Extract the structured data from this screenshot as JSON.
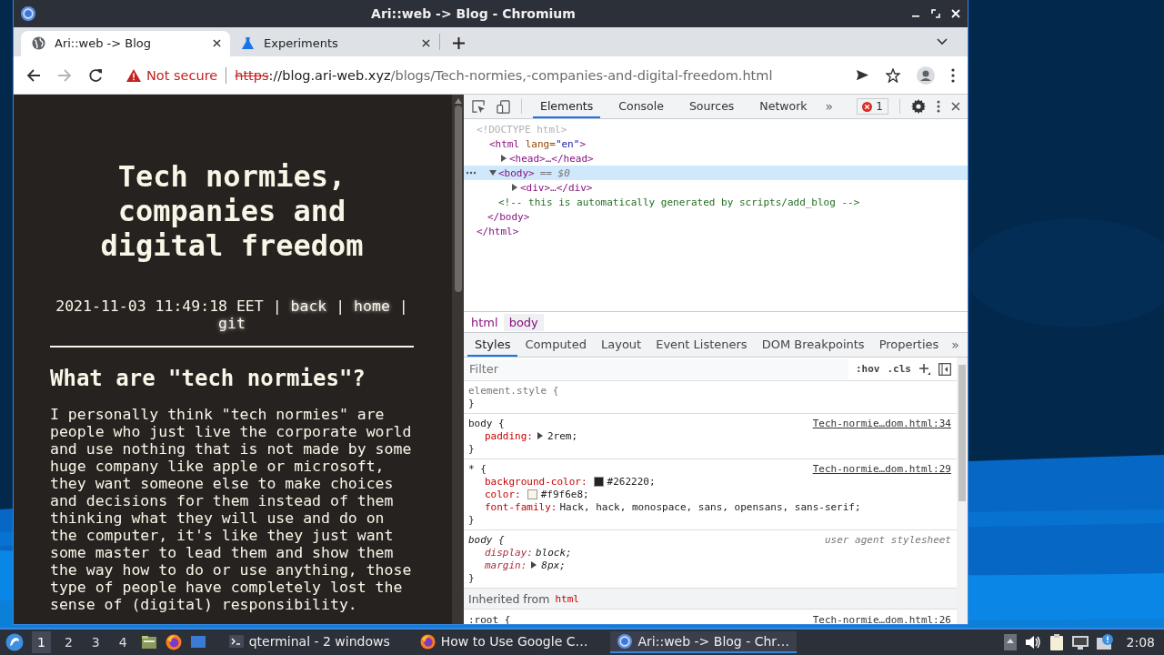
{
  "window": {
    "title": "Ari::web -> Blog - Chromium"
  },
  "tabs": [
    {
      "title": "Ari::web -> Blog",
      "kind": "globe",
      "selected": true
    },
    {
      "title": "Experiments",
      "kind": "flask",
      "selected": false
    }
  ],
  "toolbar": {
    "forward_disabled": true
  },
  "address": {
    "security": "Not secure",
    "scheme": "https",
    "host": "://blog.ari-web.xyz",
    "path": "/blogs/Tech-normies,-companies-and-digital-freedom.html"
  },
  "page": {
    "title": "Tech normies, companies and digital freedom",
    "meta": [
      {
        "kind": "text",
        "text": "2021-11-03 11:49:18 EET"
      },
      {
        "kind": "sep",
        "text": "|"
      },
      {
        "kind": "link",
        "text": "back"
      },
      {
        "kind": "sep",
        "text": "|"
      },
      {
        "kind": "link",
        "text": "home"
      },
      {
        "kind": "sep",
        "text": "|"
      },
      {
        "kind": "link",
        "text": "git"
      }
    ],
    "heading": "What are \"tech normies\"?",
    "paragraph": "I personally think \"tech normies\" are people who just live the corporate world and use nothing that is not made by some huge company like apple or microsoft, they want someone else to make choices and decisions for them instead of them thinking what they will use and do on the computer, it's like they just want some master to lead them and show them the way how to do or use anything, those type of people have completely lost the sense of (digital) responsibility."
  },
  "devtools": {
    "tabs": [
      {
        "label": "Elements",
        "selected": true
      },
      {
        "label": "Console",
        "selected": false
      },
      {
        "label": "Sources",
        "selected": false
      },
      {
        "label": "Network",
        "selected": false
      }
    ],
    "more": "»",
    "errors": "1",
    "dom": [
      {
        "kind": "doctype",
        "text": "<!DOCTYPE html>"
      },
      {
        "kind": "element",
        "text": "<html lang=\"en\">",
        "selected": false,
        "close": "</html>",
        "children": [
          {
            "kind": "element",
            "text": "<head>…</head>",
            "expanded": false,
            "selected": false
          },
          {
            "kind": "element",
            "text": "<body>",
            "suffix": "== $0",
            "expanded": true,
            "selected": true,
            "close": "</body>",
            "children": [
              {
                "kind": "element",
                "text": "<div>…</div>",
                "expanded": false,
                "selected": false
              },
              {
                "kind": "comment",
                "text": "<!-- this is automatically generated by scripts/add_blog -->"
              }
            ]
          }
        ]
      }
    ],
    "breadcrumbs": [
      {
        "label": "html",
        "selected": false
      },
      {
        "label": "body",
        "selected": true
      }
    ],
    "style_tabs": [
      {
        "label": "Styles",
        "selected": true
      },
      {
        "label": "Computed",
        "selected": false
      },
      {
        "label": "Layout",
        "selected": false
      },
      {
        "label": "Event Listeners",
        "selected": false
      },
      {
        "label": "DOM Breakpoints",
        "selected": false
      },
      {
        "label": "Properties",
        "selected": false
      }
    ],
    "style_more": "»",
    "filter": {
      "placeholder": "Filter"
    },
    "hov": ":hov",
    "cls": ".cls",
    "rules": [
      {
        "kind": "inline",
        "selector": "element.style {",
        "close": "}"
      },
      {
        "kind": "author",
        "selector": "body {",
        "source": "Tech-normie…dom.html:34",
        "close": "}",
        "props": [
          {
            "name": "padding:",
            "value": "2rem;",
            "expandable": true
          }
        ]
      },
      {
        "kind": "author",
        "selector": "* {",
        "source": "Tech-normie…dom.html:29",
        "close": "}",
        "props": [
          {
            "name": "background-color:",
            "value": "#262220;",
            "color": "#262220",
            "expandable": false
          },
          {
            "name": "color:",
            "value": "#f9f6e8;",
            "color": "#f9f6e8",
            "expandable": false
          },
          {
            "name": "font-family:",
            "value": "Hack, hack, monospace, sans, opensans, sans-serif;",
            "expandable": false
          }
        ]
      },
      {
        "kind": "user-agent",
        "selector": "body {",
        "source": "user agent stylesheet",
        "close": "}",
        "props": [
          {
            "name": "display:",
            "value": "block;",
            "expandable": false
          },
          {
            "name": "margin:",
            "value": "8px;",
            "expandable": true
          }
        ]
      }
    ],
    "inherited": {
      "label": "Inherited from",
      "from": "html"
    },
    "last_rule": {
      "selector": ":root {",
      "source": "Tech-normie…dom.html:26"
    }
  },
  "taskbar": {
    "workspaces": [
      {
        "label": "1",
        "selected": true
      },
      {
        "label": "2",
        "selected": false
      },
      {
        "label": "3",
        "selected": false
      },
      {
        "label": "4",
        "selected": false
      }
    ],
    "tasks": [
      {
        "title": "qterminal - 2 windows",
        "kind": "terminal",
        "selected": false
      },
      {
        "title": "How to Use Google C…",
        "kind": "firefox",
        "selected": false
      },
      {
        "title": "Ari::web -> Blog - Chr…",
        "kind": "chromium",
        "selected": true
      }
    ],
    "clock": "2:08"
  }
}
